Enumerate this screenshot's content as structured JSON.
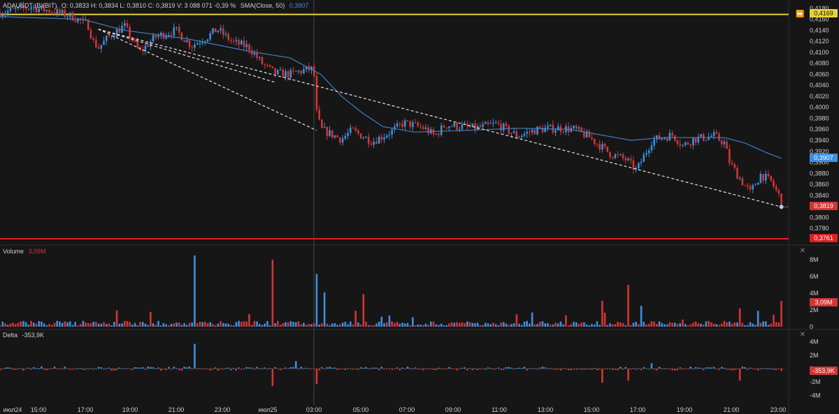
{
  "header": {
    "symbol": "ADAUSDT (BYBIT)",
    "ohlc": "O: 0,3833  H: 0,3834  L: 0,3810  C: 0,3819  V: 3 088 071  -0,39 %",
    "sma_label": "SMA(Close, 50)",
    "sma_value": "0,3907"
  },
  "price_tags": {
    "yellow_level": "0,4169",
    "sma": "0,3907",
    "last": "0,3819",
    "red_level": "0,3761"
  },
  "volume_panel": {
    "title": "Volume",
    "value": "3,09M",
    "tag": "3,09M"
  },
  "delta_panel": {
    "title": "Delta",
    "value": "-353,9K",
    "tag": "-353,9K"
  },
  "colors": {
    "background": "#161616",
    "up": "#3d8fe0",
    "down": "#d63434",
    "sma": "#3f7fc0",
    "yellow_level": "#e8d23a",
    "red_level": "#e02020"
  },
  "chart_data": {
    "type": "candlestick",
    "instrument": "ADAUSDT (BYBIT)",
    "price_axis": {
      "ticks": [
        "0,4180",
        "0,4160",
        "0,4140",
        "0,4120",
        "0,4100",
        "0,4080",
        "0,4060",
        "0,4040",
        "0,4020",
        "0,4000",
        "0,3980",
        "0,3960",
        "0,3940",
        "0,3920",
        "0,3900",
        "0,3880",
        "0,3860",
        "0,3840",
        "0,3820",
        "0,3800",
        "0,3780"
      ],
      "ylim": [
        0.3761,
        0.4185
      ]
    },
    "time_axis": {
      "ticks": [
        "июл24",
        "15:00",
        "17:00",
        "19:00",
        "21:00",
        "23:00",
        "июл25",
        "03:00",
        "05:00",
        "07:00",
        "09:00",
        "11:00",
        "13:00",
        "15:00",
        "17:00",
        "19:00",
        "21:00",
        "23:00"
      ]
    },
    "horizontal_levels": [
      {
        "price": 0.4169,
        "color": "yellow"
      },
      {
        "price": 0.3761,
        "color": "red"
      }
    ],
    "price_path": [
      [
        0,
        0.4172
      ],
      [
        3,
        0.4182
      ],
      [
        5,
        0.4175
      ],
      [
        7,
        0.4165
      ],
      [
        8.5,
        0.415
      ],
      [
        9,
        0.412
      ],
      [
        9.5,
        0.4108
      ],
      [
        10.5,
        0.4128
      ],
      [
        12,
        0.4148
      ],
      [
        13.5,
        0.41
      ],
      [
        15,
        0.4128
      ],
      [
        17,
        0.414
      ],
      [
        18.5,
        0.4112
      ],
      [
        20,
        0.4128
      ],
      [
        21,
        0.4142
      ],
      [
        22.5,
        0.4118
      ],
      [
        24,
        0.411
      ],
      [
        25.3,
        0.408
      ],
      [
        26.5,
        0.4062
      ],
      [
        28,
        0.406
      ],
      [
        29.5,
        0.4068
      ],
      [
        30.3,
        0.407
      ],
      [
        30.6,
        0.399
      ],
      [
        31,
        0.396
      ],
      [
        33,
        0.3942
      ],
      [
        34,
        0.3958
      ],
      [
        36,
        0.3938
      ],
      [
        38,
        0.3958
      ],
      [
        39,
        0.3972
      ],
      [
        41,
        0.3962
      ],
      [
        42,
        0.3948
      ],
      [
        43,
        0.3968
      ],
      [
        46,
        0.3962
      ],
      [
        48,
        0.397
      ],
      [
        50,
        0.3948
      ],
      [
        52,
        0.396
      ],
      [
        54,
        0.3962
      ],
      [
        55.5,
        0.396
      ],
      [
        57,
        0.3945
      ],
      [
        59,
        0.3915
      ],
      [
        60.5,
        0.3905
      ],
      [
        61.5,
        0.3885
      ],
      [
        63,
        0.394
      ],
      [
        65,
        0.395
      ],
      [
        66,
        0.393
      ],
      [
        67,
        0.3942
      ],
      [
        69,
        0.3948
      ],
      [
        70,
        0.3935
      ],
      [
        70.5,
        0.39
      ],
      [
        71.5,
        0.387
      ],
      [
        72.5,
        0.3845
      ],
      [
        73.5,
        0.3878
      ],
      [
        74.5,
        0.3865
      ],
      [
        75.3,
        0.3838
      ],
      [
        75.5,
        0.3819
      ]
    ],
    "sma50": {
      "name": "SMA(Close, 50)",
      "last": 0.3907,
      "points": [
        [
          0,
          0.4165
        ],
        [
          8,
          0.416
        ],
        [
          12,
          0.414
        ],
        [
          18,
          0.4125
        ],
        [
          24,
          0.4102
        ],
        [
          28,
          0.409
        ],
        [
          31,
          0.406
        ],
        [
          33,
          0.402
        ],
        [
          35,
          0.399
        ],
        [
          37,
          0.3965
        ],
        [
          40,
          0.3955
        ],
        [
          45,
          0.3958
        ],
        [
          50,
          0.3962
        ],
        [
          55,
          0.396
        ],
        [
          58,
          0.395
        ],
        [
          61,
          0.394
        ],
        [
          64,
          0.3945
        ],
        [
          67,
          0.3945
        ],
        [
          70,
          0.3945
        ],
        [
          72,
          0.3935
        ],
        [
          74,
          0.3918
        ],
        [
          75.5,
          0.3907
        ]
      ]
    },
    "trendlines": [
      {
        "x0": 9.5,
        "y0": 0.4142,
        "x1": 75.5,
        "y1": 0.3819
      },
      {
        "x0": 9.5,
        "y0": 0.4142,
        "x1": 30.6,
        "y1": 0.3958
      },
      {
        "x0": 9.5,
        "y0": 0.4142,
        "x1": 26.5,
        "y1": 0.4046
      }
    ],
    "volume": {
      "axis_ticks": [
        "8M",
        "6M",
        "4M",
        "2M",
        "0"
      ],
      "ylim": [
        0,
        9000000
      ],
      "last": 3090000,
      "spikes": [
        [
          18.9,
          8500000,
          "up"
        ],
        [
          26.3,
          8000000,
          "down"
        ],
        [
          30.5,
          8100000,
          "down"
        ],
        [
          30.7,
          6300000,
          "up"
        ],
        [
          31.3,
          4100000,
          "up"
        ],
        [
          35.2,
          3900000,
          "down"
        ],
        [
          58.2,
          3100000,
          "down"
        ],
        [
          60.6,
          5000000,
          "down"
        ],
        [
          62,
          2500000,
          "up"
        ],
        [
          71.5,
          2200000,
          "down"
        ],
        [
          73.3,
          1900000,
          "up"
        ],
        [
          75.4,
          3090000,
          "down"
        ]
      ],
      "baseline_range": [
        200000,
        700000
      ]
    },
    "delta": {
      "axis_ticks": [
        "4M",
        "2M",
        "0",
        "-2M",
        "-4M"
      ],
      "ylim": [
        -5000000,
        5000000
      ],
      "last": -353900,
      "spikes": [
        [
          18.9,
          3700000
        ],
        [
          26.3,
          -2600000
        ],
        [
          30.5,
          -4100000
        ],
        [
          30.7,
          -2300000
        ],
        [
          28.5,
          1100000
        ],
        [
          63,
          800000
        ],
        [
          60.6,
          -1800000
        ],
        [
          58.2,
          -2100000
        ],
        [
          71.5,
          -1800000
        ],
        [
          75.4,
          -353900
        ]
      ],
      "baseline_range": [
        -600000,
        600000
      ]
    }
  }
}
